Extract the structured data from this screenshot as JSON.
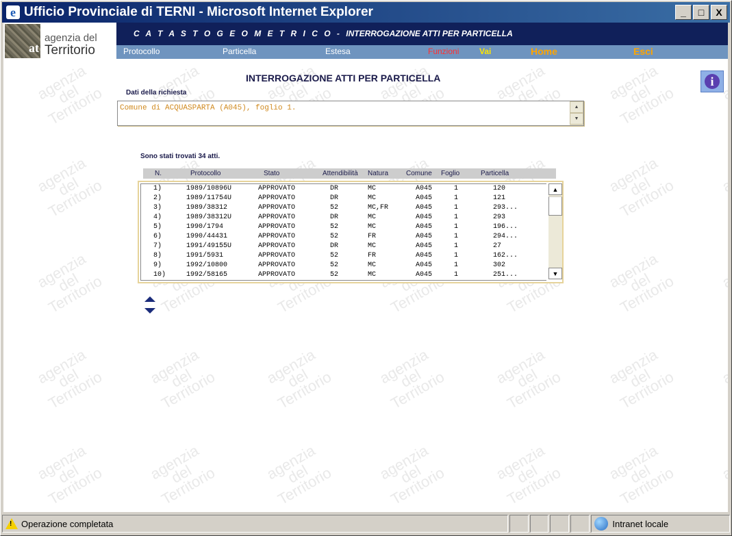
{
  "window": {
    "title": "Ufficio Provinciale di TERNI - Microsoft Internet Explorer",
    "btn_min": "_",
    "btn_max": "□",
    "btn_close": "X",
    "icon_glyph": "e"
  },
  "logo": {
    "line1": "agenzia del",
    "line2": "Territorio",
    "mark": "at"
  },
  "header": {
    "title_a": "C A T A S T O   G E O M E T R I C O - ",
    "title_b": "INTERROGAZIONE ATTI PER PARTICELLA"
  },
  "menu": {
    "protocollo": "Protocollo",
    "particella": "Particella",
    "estesa": "Estesa",
    "funzioni": "Funzioni",
    "vai": "Vai",
    "home": "Home",
    "esci": "Esci"
  },
  "page": {
    "title": "INTERROGAZIONE ATTI PER PARTICELLA",
    "info_glyph": "i",
    "request_label": "Dati della richiesta",
    "request_text": "Comune di ACQUASPARTA (A045), foglio 1.",
    "count_text": "Sono stati trovati 34 atti."
  },
  "table": {
    "headers": {
      "n": "N.",
      "protocollo": "Protocollo",
      "stato": "Stato",
      "attendibilita": "Attendibilità",
      "natura": "Natura",
      "comune": "Comune",
      "foglio": "Foglio",
      "particella": "Particella"
    },
    "rows": [
      {
        "n": "1)",
        "protocollo": "1989/10896U",
        "stato": "APPROVATO",
        "att": "DR",
        "natura": "MC",
        "comune": "A045",
        "foglio": "1",
        "particella": "120"
      },
      {
        "n": "2)",
        "protocollo": "1989/11754U",
        "stato": "APPROVATO",
        "att": "DR",
        "natura": "MC",
        "comune": "A045",
        "foglio": "1",
        "particella": "121"
      },
      {
        "n": "3)",
        "protocollo": "1989/38312",
        "stato": "APPROVATO",
        "att": "52",
        "natura": "MC,FR",
        "comune": "A045",
        "foglio": "1",
        "particella": "293..."
      },
      {
        "n": "4)",
        "protocollo": "1989/38312U",
        "stato": "APPROVATO",
        "att": "DR",
        "natura": "MC",
        "comune": "A045",
        "foglio": "1",
        "particella": "293"
      },
      {
        "n": "5)",
        "protocollo": "1990/1794",
        "stato": "APPROVATO",
        "att": "52",
        "natura": "MC",
        "comune": "A045",
        "foglio": "1",
        "particella": "196..."
      },
      {
        "n": "6)",
        "protocollo": "1990/44431",
        "stato": "APPROVATO",
        "att": "52",
        "natura": "FR",
        "comune": "A045",
        "foglio": "1",
        "particella": "294..."
      },
      {
        "n": "7)",
        "protocollo": "1991/49155U",
        "stato": "APPROVATO",
        "att": "DR",
        "natura": "MC",
        "comune": "A045",
        "foglio": "1",
        "particella": "27"
      },
      {
        "n": "8)",
        "protocollo": "1991/5931",
        "stato": "APPROVATO",
        "att": "52",
        "natura": "FR",
        "comune": "A045",
        "foglio": "1",
        "particella": "162..."
      },
      {
        "n": "9)",
        "protocollo": "1992/10800",
        "stato": "APPROVATO",
        "att": "52",
        "natura": "MC",
        "comune": "A045",
        "foglio": "1",
        "particella": "302"
      },
      {
        "n": "10)",
        "protocollo": "1992/58165",
        "stato": "APPROVATO",
        "att": "52",
        "natura": "MC",
        "comune": "A045",
        "foglio": "1",
        "particella": "251..."
      }
    ]
  },
  "status": {
    "text": "Operazione completata",
    "zone": "Intranet locale"
  },
  "watermark": {
    "line1": "agenzia del",
    "line2": "Territorio"
  },
  "colors": {
    "header_bg": "#10205a",
    "menu_bg": "#6f94bf",
    "request_text": "#d08a20"
  },
  "icons": {
    "ie": "ie-icon",
    "info": "info-icon",
    "warning": "warning-icon",
    "globe": "intranet-globe-icon"
  }
}
